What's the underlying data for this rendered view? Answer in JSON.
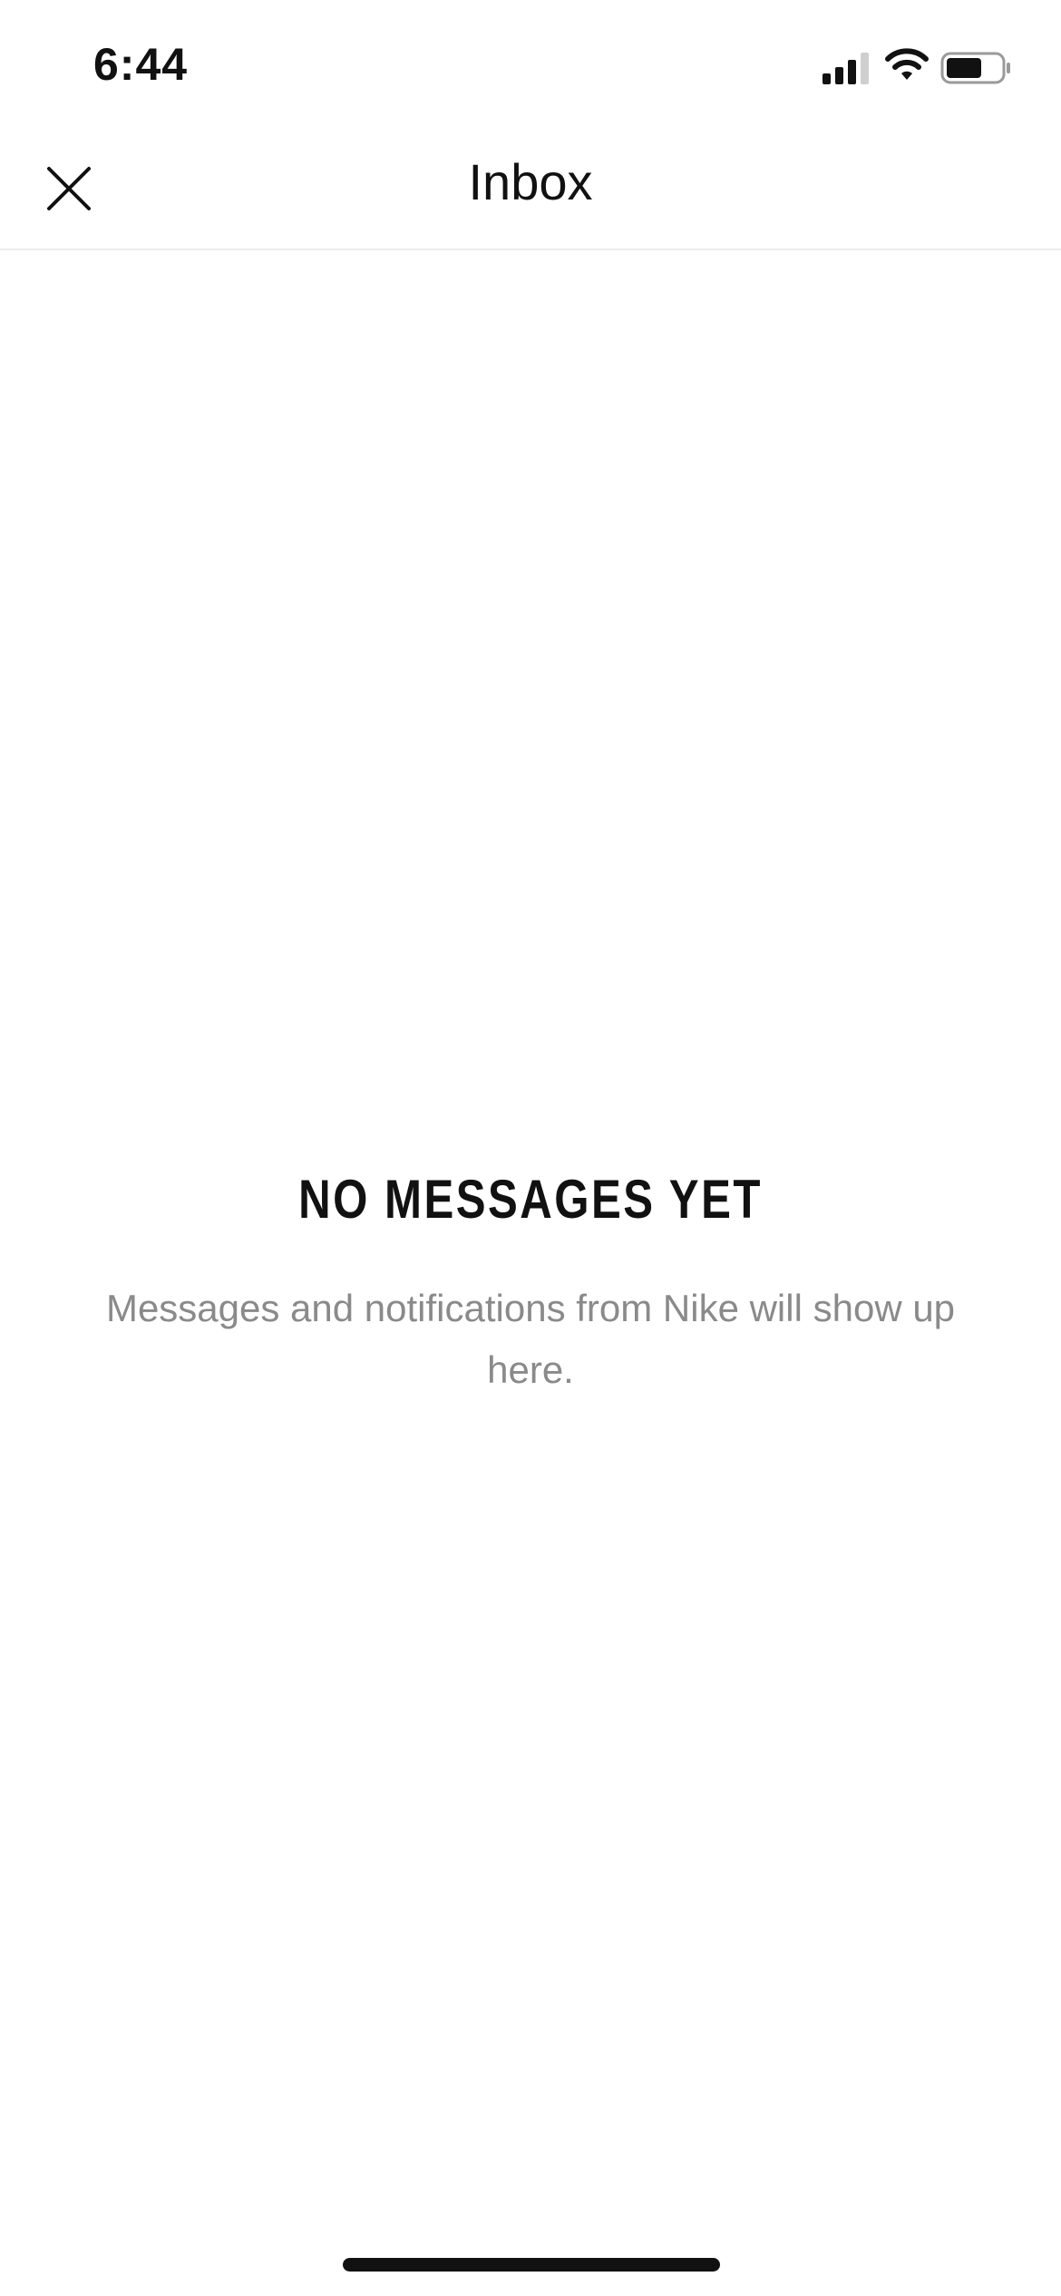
{
  "status_bar": {
    "time": "6:44"
  },
  "header": {
    "title": "Inbox",
    "close_icon": "close-icon"
  },
  "empty_state": {
    "title": "NO MESSAGES YET",
    "message": "Messages and notifications from Nike will show up here."
  },
  "colors": {
    "text_primary": "#111111",
    "text_secondary": "#8a8a8a",
    "divider": "#ececec",
    "background": "#ffffff"
  }
}
